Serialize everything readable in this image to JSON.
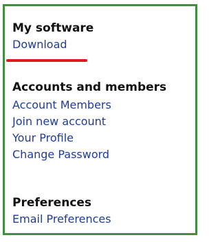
{
  "sections": [
    {
      "heading": "My software",
      "links": [
        "Download"
      ]
    },
    {
      "heading": "Accounts and members",
      "links": [
        "Account Members",
        "Join new account",
        "Your Profile",
        "Change Password"
      ]
    },
    {
      "heading": "Preferences",
      "links": [
        "Email Preferences"
      ]
    }
  ],
  "highlight": {
    "color": "#e0191e",
    "target": "Download"
  },
  "colors": {
    "border": "#3f8f3f",
    "link": "#1f3c99",
    "heading": "#111111"
  }
}
